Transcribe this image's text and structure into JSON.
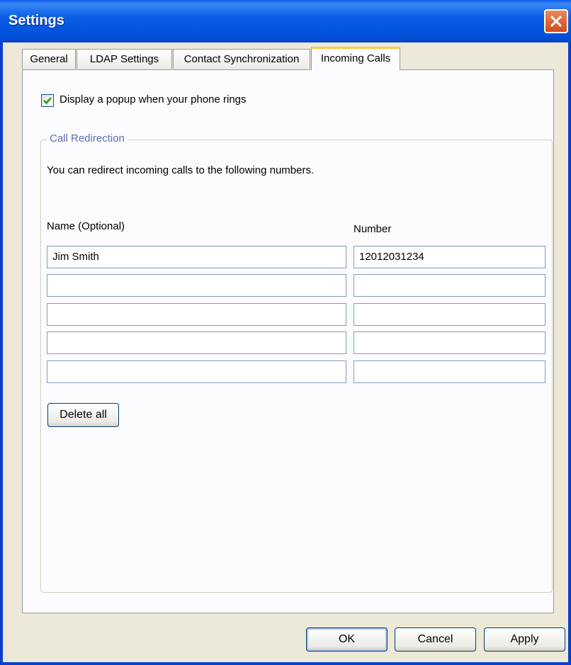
{
  "window": {
    "title": "Settings",
    "close_icon": "close-icon"
  },
  "tabs": [
    {
      "label": "General",
      "active": false
    },
    {
      "label": "LDAP Settings",
      "active": false
    },
    {
      "label": "Contact Synchronization",
      "active": false
    },
    {
      "label": "Incoming Calls",
      "active": true
    }
  ],
  "popup_option": {
    "label": "Display a popup when your phone rings",
    "checked": true
  },
  "redirection": {
    "group_title": "Call Redirection",
    "description": "You can redirect incoming calls to the following numbers.",
    "name_header": "Name (Optional)",
    "number_header": "Number",
    "rows": [
      {
        "name": "Jim Smith",
        "number": "12012031234"
      },
      {
        "name": "",
        "number": ""
      },
      {
        "name": "",
        "number": ""
      },
      {
        "name": "",
        "number": ""
      },
      {
        "name": "",
        "number": ""
      }
    ],
    "delete_all_label": "Delete all"
  },
  "footer": {
    "ok_label": "OK",
    "cancel_label": "Cancel",
    "apply_label": "Apply"
  },
  "colors": {
    "titlebar": "#0055e5",
    "group_title": "#5b6fb8",
    "active_tab_highlight": "#ffc83c"
  }
}
